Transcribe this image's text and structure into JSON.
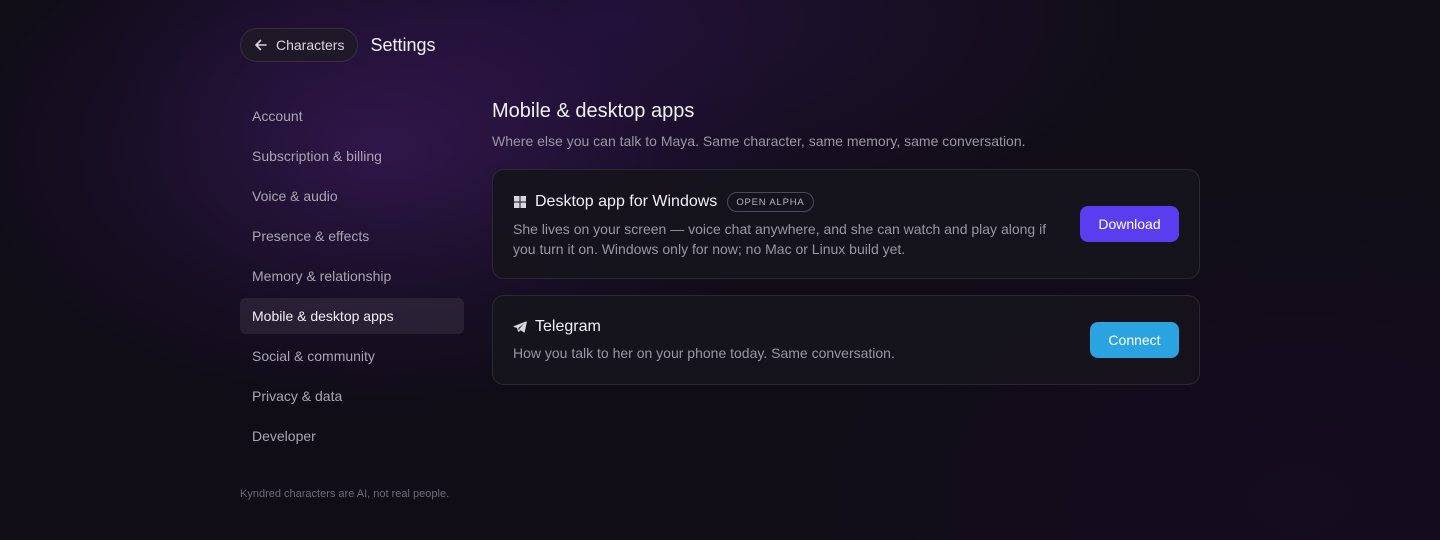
{
  "header": {
    "back_label": "Characters",
    "title": "Settings"
  },
  "sidebar": {
    "items": [
      {
        "label": "Account"
      },
      {
        "label": "Subscription & billing"
      },
      {
        "label": "Voice & audio"
      },
      {
        "label": "Presence & effects"
      },
      {
        "label": "Memory & relationship"
      },
      {
        "label": "Mobile & desktop apps",
        "active": true
      },
      {
        "label": "Social & community"
      },
      {
        "label": "Privacy & data"
      },
      {
        "label": "Developer"
      }
    ]
  },
  "footer_note": "Kyndred characters are AI, not real people.",
  "main": {
    "title": "Mobile & desktop apps",
    "subtitle": "Where else you can talk to Maya. Same character, same memory, same conversation.",
    "cards": [
      {
        "icon": "windows-icon",
        "title": "Desktop app for Windows",
        "badge": "OPEN ALPHA",
        "description": "She lives on your screen — voice chat anywhere, and she can watch and play along if you turn it on. Windows only for now; no Mac or Linux build yet.",
        "button_label": "Download",
        "button_color": "#5b3df0"
      },
      {
        "icon": "telegram-icon",
        "title": "Telegram",
        "description": "How you talk to her on your phone today. Same conversation.",
        "button_label": "Connect",
        "button_color": "#2aa3e0"
      }
    ]
  },
  "colors": {
    "background": "#100d17",
    "accent_purple": "#5b3df0",
    "accent_blue": "#2aa3e0"
  }
}
